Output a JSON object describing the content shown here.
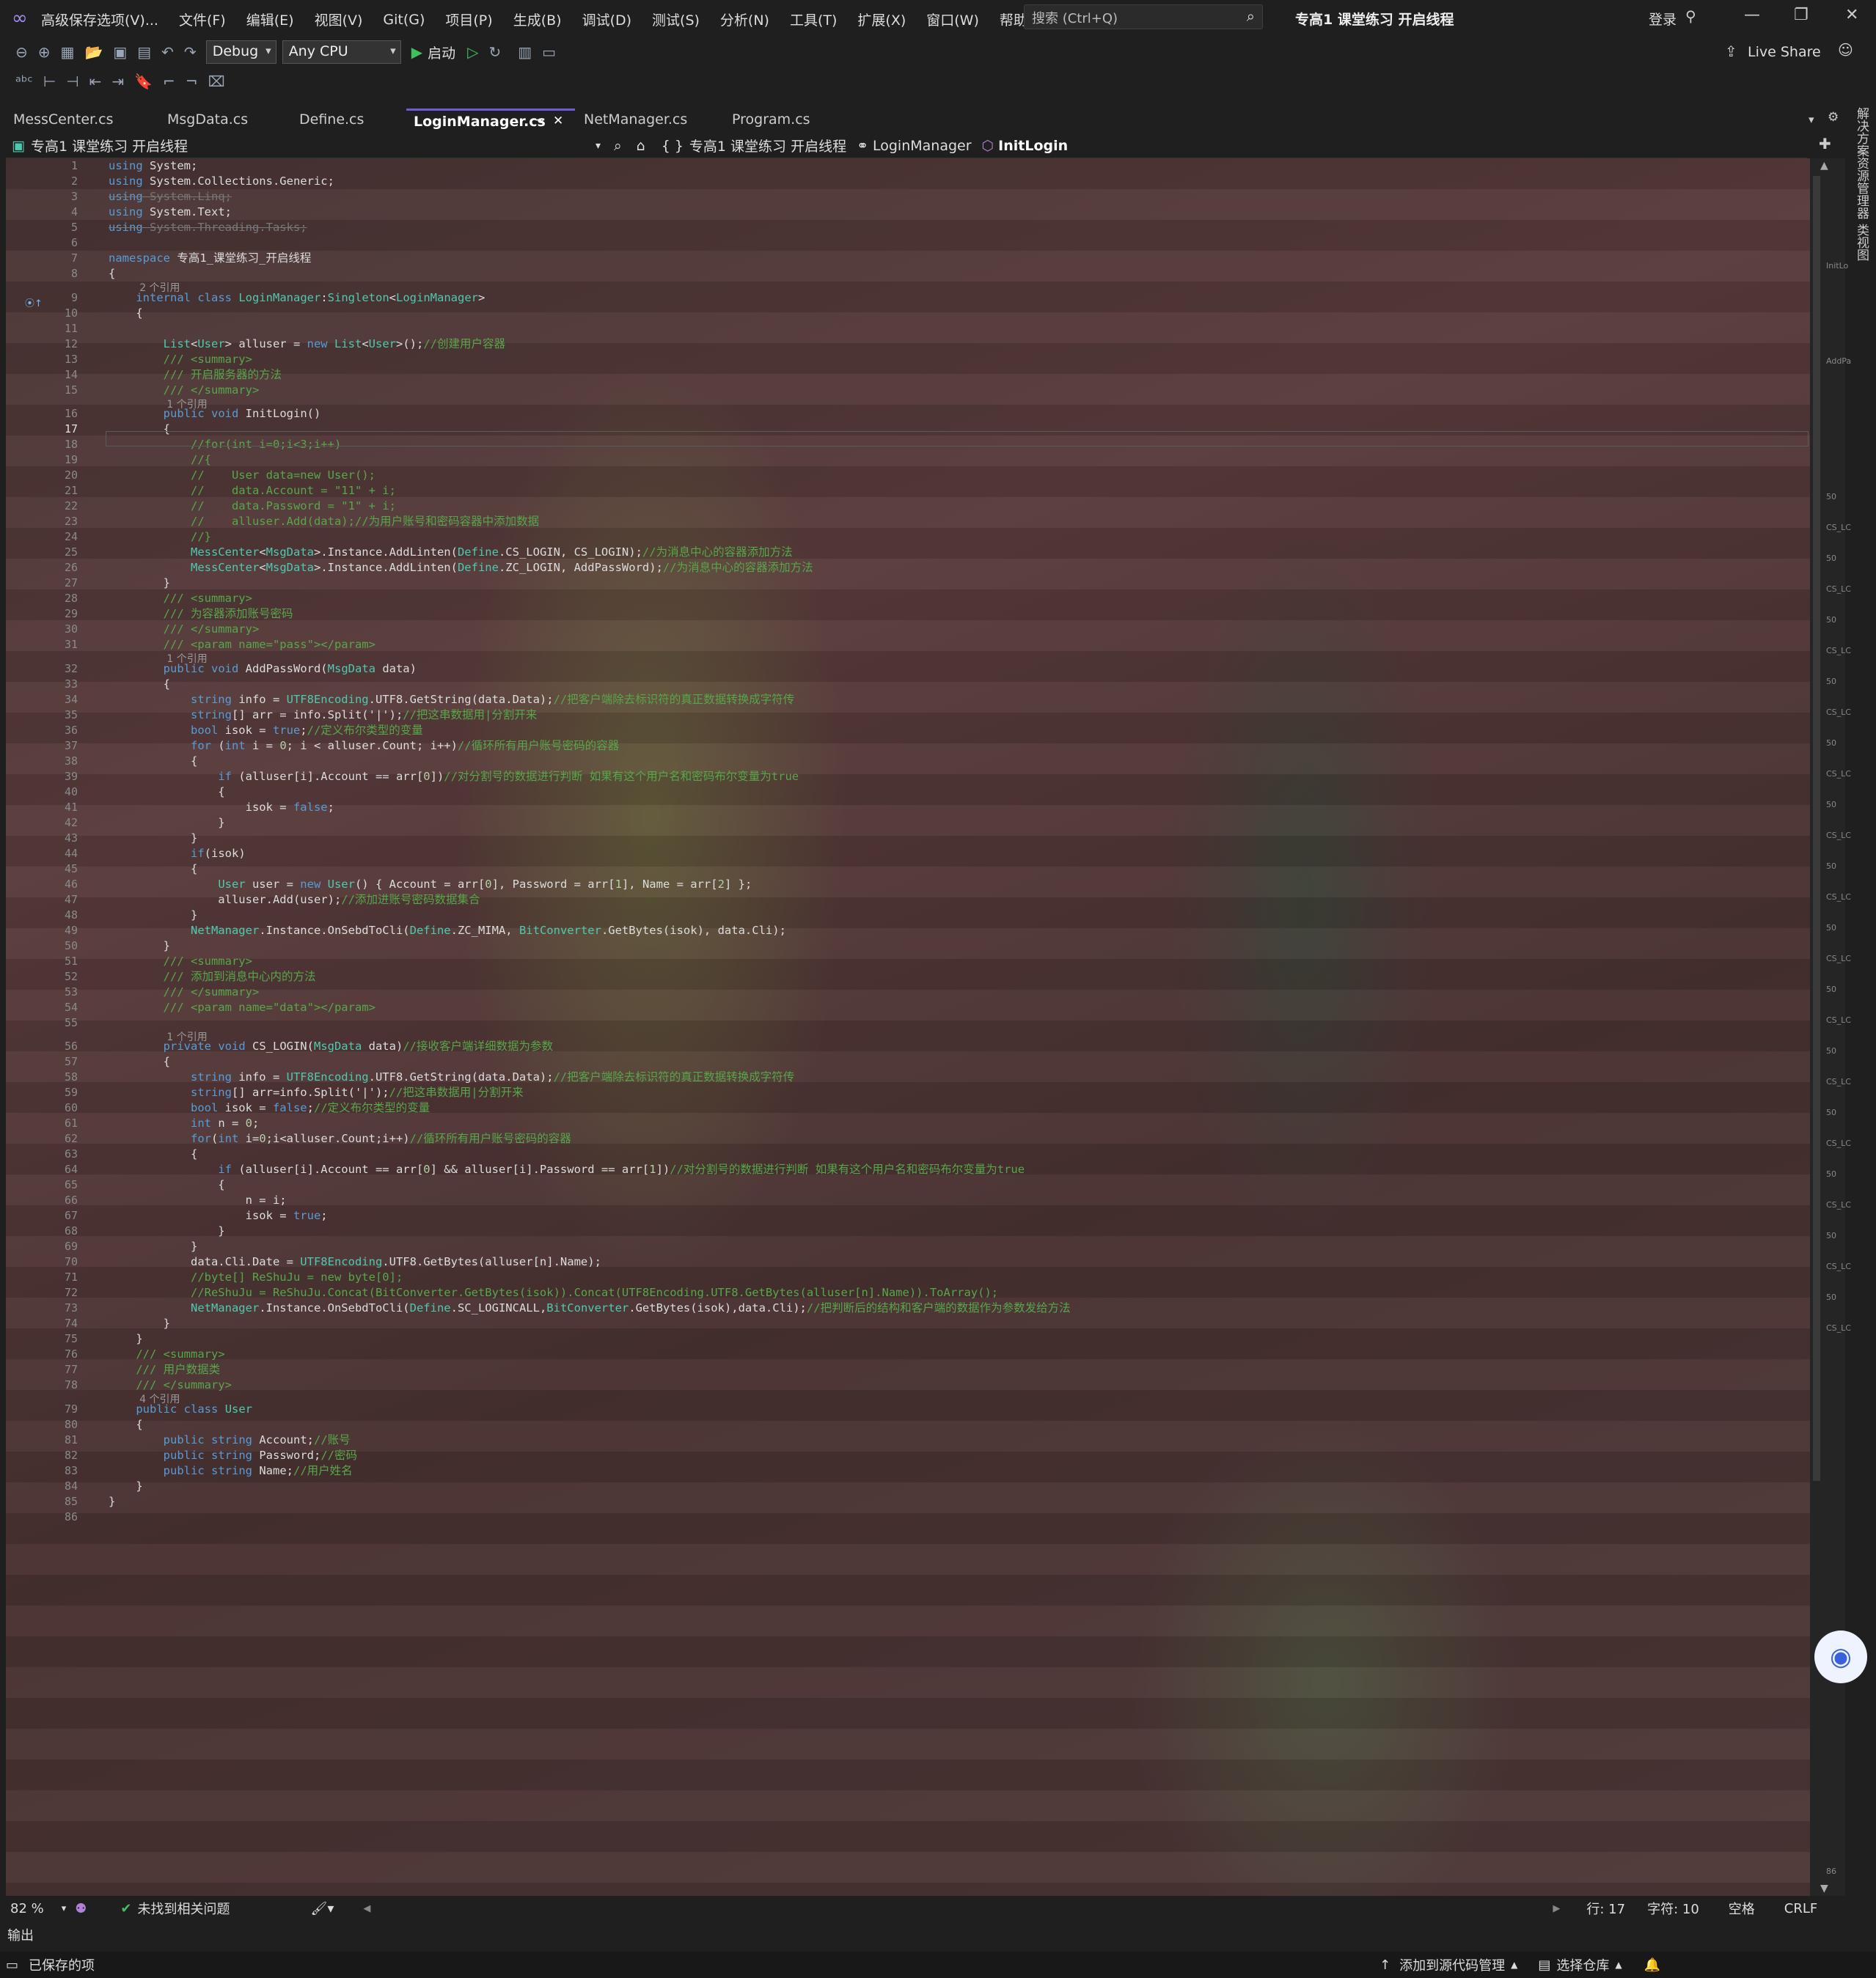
{
  "menu": [
    "高级保存选项(V)...",
    "文件(F)",
    "编辑(E)",
    "视图(V)",
    "Git(G)",
    "项目(P)",
    "生成(B)",
    "调试(D)",
    "测试(S)",
    "分析(N)",
    "工具(T)",
    "扩展(X)",
    "窗口(W)",
    "帮助(H)"
  ],
  "search": {
    "placeholder": "搜索 (Ctrl+Q)"
  },
  "window_title": "专高1 课堂练习 开启线程",
  "login": "登录",
  "toolbar": {
    "config": "Debug",
    "platform": "Any CPU",
    "start": "启动",
    "live_share": "Live Share"
  },
  "tabs": [
    "MessCenter.cs",
    "MsgData.cs",
    "Define.cs",
    "LoginManager.cs",
    "NetManager.cs",
    "Program.cs"
  ],
  "nav": {
    "project": "专高1 课堂练习 开启线程",
    "namespace": "专高1 课堂练习 开启线程",
    "class": "LoginManager",
    "member": "InitLogin"
  },
  "right_panels": [
    "解决方案资源管理器",
    "类视图"
  ],
  "code_lines": [
    "using System;",
    "using System.Collections.Generic;",
    "using System.Linq;",
    "using System.Text;",
    "using System.Threading.Tasks;",
    "",
    "namespace 专高1_课堂练习_开启线程",
    "{",
    "    internal class LoginManager:Singleton<LoginManager>",
    "    {",
    "",
    "        List<User> alluser = new List<User>();//创建用户容器",
    "        /// <summary>",
    "        /// 开启服务器的方法",
    "        /// </summary>",
    "        public void InitLogin()",
    "        {",
    "            //for(int i=0;i<3;i++)",
    "            //{",
    "            //    User data=new User();",
    "            //    data.Account = \"11\" + i;",
    "            //    data.Password = \"1\" + i;",
    "            //    alluser.Add(data);//为用户账号和密码容器中添加数据",
    "            //}",
    "            MessCenter<MsgData>.Instance.AddLinten(Define.CS_LOGIN, CS_LOGIN);//为消息中心的容器添加方法",
    "            MessCenter<MsgData>.Instance.AddLinten(Define.ZC_LOGIN, AddPassWord);//为消息中心的容器添加方法",
    "        }",
    "        /// <summary>",
    "        /// 为容器添加账号密码",
    "        /// </summary>",
    "        /// <param name=\"pass\"></param>",
    "        public void AddPassWord(MsgData data)",
    "        {",
    "            string info = UTF8Encoding.UTF8.GetString(data.Data);//把客户端除去标识符的真正数据转换成字符传",
    "            string[] arr = info.Split('|');//把这串数据用|分割开来",
    "            bool isok = true;//定义布尔类型的变量",
    "            for (int i = 0; i < alluser.Count; i++)//循环所有用户账号密码的容器",
    "            {",
    "                if (alluser[i].Account == arr[0])//对分割号的数据进行判断 如果有这个用户名和密码布尔变量为true",
    "                {",
    "                    isok = false;",
    "                }",
    "            }",
    "            if(isok)",
    "            {",
    "                User user = new User() { Account = arr[0], Password = arr[1], Name = arr[2] };",
    "                alluser.Add(user);//添加进账号密码数据集合",
    "            }",
    "            NetManager.Instance.OnSebdToCli(Define.ZC_MIMA, BitConverter.GetBytes(isok), data.Cli);",
    "        }",
    "        /// <summary>",
    "        /// 添加到消息中心内的方法",
    "        /// </summary>",
    "        /// <param name=\"data\"></param>",
    "",
    "        private void CS_LOGIN(MsgData data)//接收客户端详细数据为参数",
    "        {",
    "            string info = UTF8Encoding.UTF8.GetString(data.Data);//把客户端除去标识符的真正数据转换成字符传",
    "            string[] arr=info.Split('|');//把这串数据用|分割开来",
    "            bool isok = false;//定义布尔类型的变量",
    "            int n = 0;",
    "            for(int i=0;i<alluser.Count;i++)//循环所有用户账号密码的容器",
    "            {",
    "                if (alluser[i].Account == arr[0] && alluser[i].Password == arr[1])//对分割号的数据进行判断 如果有这个用户名和密码布尔变量为true",
    "                {",
    "                    n = i;",
    "                    isok = true;",
    "                }",
    "            }",
    "            data.Cli.Date = UTF8Encoding.UTF8.GetBytes(alluser[n].Name);",
    "            //byte[] ReShuJu = new byte[0];",
    "            //ReShuJu = ReShuJu.Concat(BitConverter.GetBytes(isok)).Concat(UTF8Encoding.UTF8.GetBytes(alluser[n].Name)).ToArray();",
    "            NetManager.Instance.OnSebdToCli(Define.SC_LOGINCALL,BitConverter.GetBytes(isok),data.Cli);//把判断后的结构和客户端的数据作为参数发给方法",
    "        }",
    "    }",
    "    /// <summary>",
    "    /// 用户数据类",
    "    /// </summary>",
    "    public class User",
    "    {",
    "        public string Account;//账号",
    "        public string Password;//密码",
    "        public string Name;//用户姓名",
    "    }",
    "}",
    ""
  ],
  "ref_labels": {
    "8": "2 个引用",
    "15": "1 个引用",
    "31": "1 个引用",
    "55": "1 个引用",
    "78": "4 个引用"
  },
  "status": {
    "zoom": "82 %",
    "issues": "未找到相关问题",
    "line": "行: 17",
    "char": "字符: 10",
    "spaces": "空格",
    "eol": "CRLF"
  },
  "output_label": "输出",
  "bottom": {
    "saved": "已保存的项",
    "source_control": "添加到源代码管理",
    "repo": "选择仓库"
  },
  "minimap_marks": {
    "init": "InitLo",
    "add": "AddPa",
    "num": "50",
    "cs": "CS_LC",
    "end": "86"
  }
}
